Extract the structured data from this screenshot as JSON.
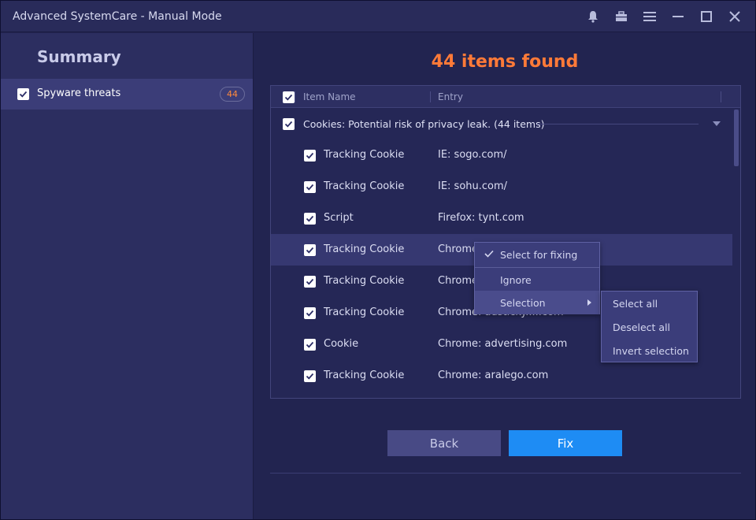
{
  "window": {
    "title": "Advanced SystemCare - Manual Mode"
  },
  "titlebar_icons": [
    "bell-icon",
    "toolbox-icon",
    "menu-icon",
    "minimize-icon",
    "maximize-icon",
    "close-icon"
  ],
  "sidebar": {
    "heading": "Summary",
    "item": {
      "label": "Spyware threats",
      "count": "44",
      "checked": true
    }
  },
  "main": {
    "found_title": "44 items found",
    "columns": {
      "name": "Item Name",
      "entry": "Entry"
    },
    "group": {
      "label": "Cookies: Potential risk of privacy leak. (44 items)"
    },
    "rows": [
      {
        "name": "Tracking Cookie",
        "entry": "IE: sogo.com/"
      },
      {
        "name": "Tracking Cookie",
        "entry": "IE: sohu.com/"
      },
      {
        "name": "Script",
        "entry": "Firefox: tynt.com"
      },
      {
        "name": "Tracking Cookie",
        "entry": "Chrome"
      },
      {
        "name": "Tracking Cookie",
        "entry": "Chrome"
      },
      {
        "name": "Tracking Cookie",
        "entry": "Chrome: adsticky.....com"
      },
      {
        "name": "Cookie",
        "entry": "Chrome: advertising.com"
      },
      {
        "name": "Tracking Cookie",
        "entry": "Chrome: aralego.com"
      }
    ],
    "buttons": {
      "back": "Back",
      "fix": "Fix"
    }
  },
  "context_menu": {
    "items": [
      "Select for fixing",
      "Ignore",
      "Selection"
    ],
    "submenu": [
      "Select all",
      "Deselect all",
      "Invert selection"
    ]
  },
  "colors": {
    "accent_orange": "#ff7a38",
    "fix_blue": "#1e8cf4",
    "background": "#222450"
  }
}
